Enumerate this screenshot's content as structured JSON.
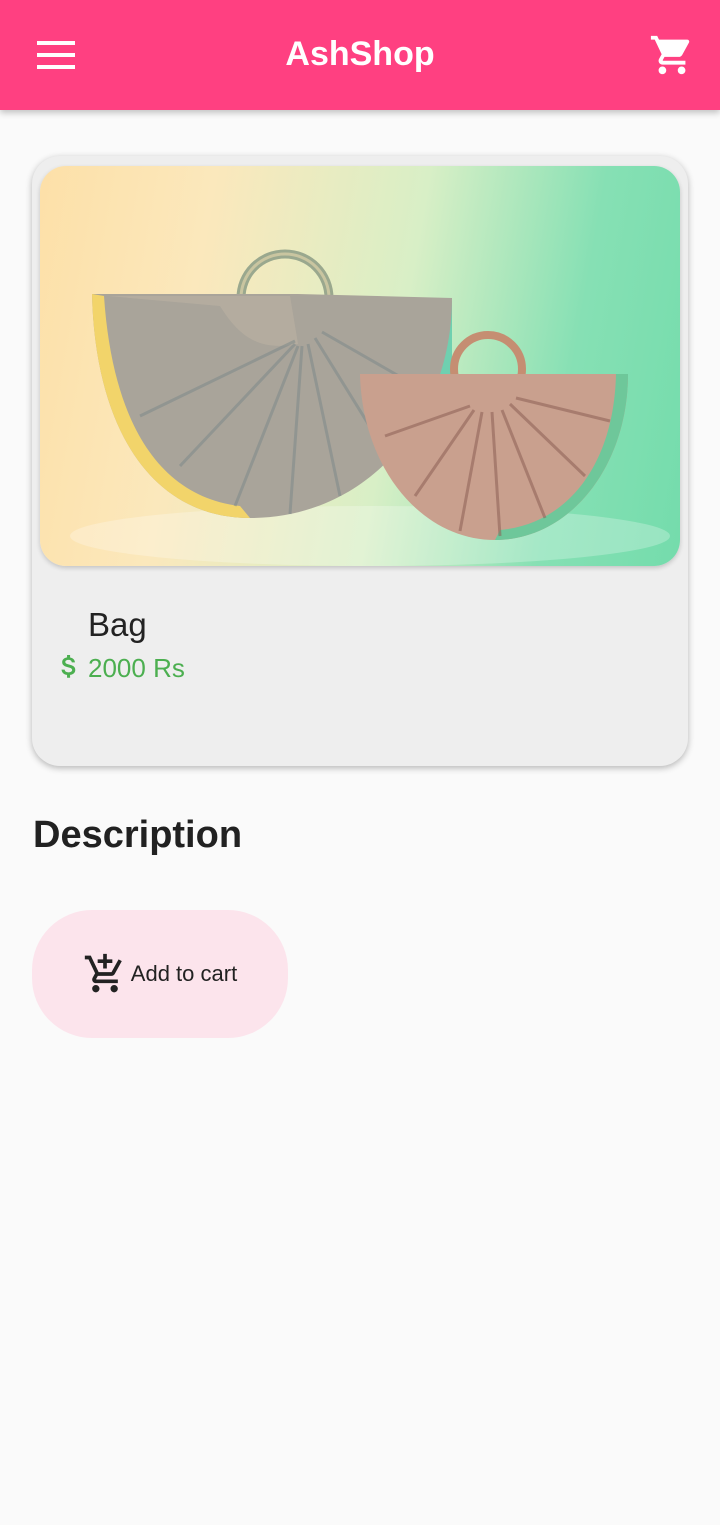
{
  "appbar": {
    "title": "AshShop",
    "menu_icon": "menu-icon",
    "cart_icon": "shopping-cart-icon",
    "color": "#ff4081"
  },
  "product": {
    "name": "Bag",
    "price": "2000 Rs",
    "price_icon": "dollar-icon",
    "price_color": "#4caf50",
    "image": "photo of two half-moon handbags with ring handles"
  },
  "description": {
    "heading": "Description"
  },
  "add_to_cart": {
    "label": "Add to cart",
    "icon": "add-shopping-cart-icon",
    "background": "#fce4ec"
  }
}
